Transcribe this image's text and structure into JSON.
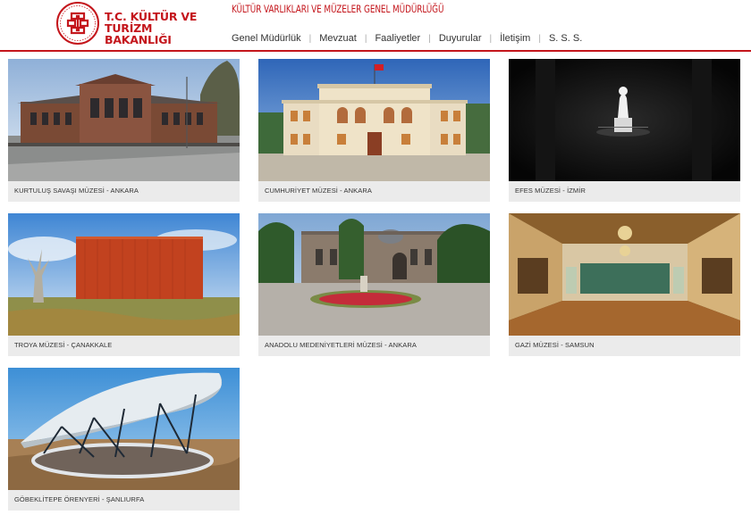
{
  "header": {
    "logo_line1": "T.C. KÜLTÜR VE TURİZM",
    "logo_line2": "BAKANLIĞI",
    "department": "KÜLTÜR VARLIKLARI VE MÜZELER GENEL MÜDÜRLÜĞÜ"
  },
  "nav": [
    {
      "label": "Genel Müdürlük"
    },
    {
      "label": "Mevzuat"
    },
    {
      "label": "Faaliyetler"
    },
    {
      "label": "Duyurular"
    },
    {
      "label": "İletişim"
    },
    {
      "label": "S. S. S."
    }
  ],
  "museums": [
    {
      "caption": "KURTULUŞ SAVAŞI MÜZESİ - ANKARA"
    },
    {
      "caption": "CUMHURİYET MÜZESİ - ANKARA"
    },
    {
      "caption": "EFES MÜZESİ - İZMİR"
    },
    {
      "caption": "TROYA MÜZESİ - ÇANAKKALE"
    },
    {
      "caption": "ANADOLU MEDENİYETLERİ MÜZESİ - ANKARA"
    },
    {
      "caption": "GAZİ MÜZESİ - SAMSUN"
    },
    {
      "caption": "GÖBEKLİTEPE ÖRENYERİ - ŞANLIURFA"
    }
  ],
  "colors": {
    "brand_red": "#c4161c",
    "caption_bg": "#ebebeb"
  }
}
